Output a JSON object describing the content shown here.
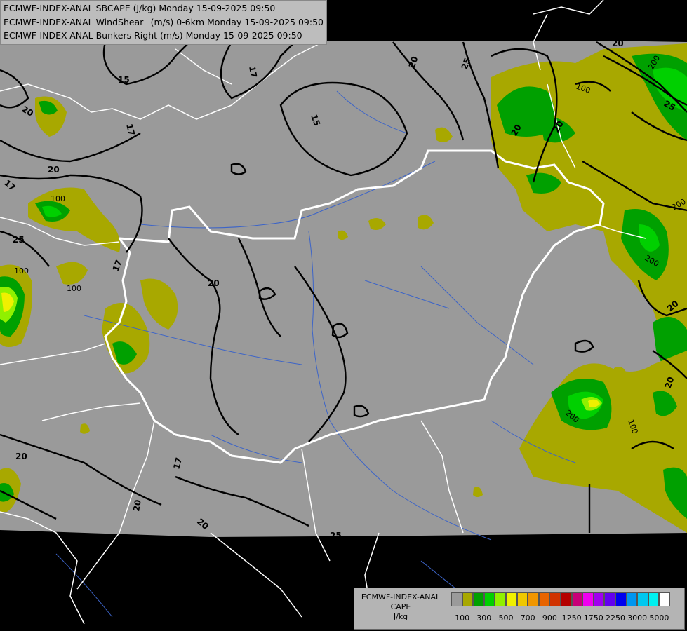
{
  "header": {
    "line1": "ECMWF-INDEX-ANAL SBCAPE (J/kg) Monday 15-09-2025 09:50",
    "line2": "ECMWF-INDEX-ANAL WindShear_ (m/s) 0-6km Monday 15-09-2025 09:50",
    "line3": "ECMWF-INDEX-ANAL Bunkers Right (m/s) Monday 15-09-2025 09:50"
  },
  "legend": {
    "title1": "ECMWF-INDEX-ANAL",
    "title2": "CAPE",
    "title3": "J/kg",
    "colors": [
      "#9a9a9a",
      "#a8a800",
      "#00a000",
      "#00d000",
      "#90f000",
      "#f0f000",
      "#f0c800",
      "#f09600",
      "#e86400",
      "#d03200",
      "#b40000",
      "#c80078",
      "#f000f0",
      "#a000f0",
      "#6400f0",
      "#0000f0",
      "#0096f0",
      "#00c8f0",
      "#00f0f0",
      "#ffffff"
    ],
    "tick_labels": [
      "100",
      "300",
      "500",
      "700",
      "900",
      "1250",
      "1750",
      "2250",
      "3000",
      "5000"
    ]
  },
  "contour_labels": {
    "windshear": [
      "15",
      "15",
      "17",
      "17",
      "17",
      "17",
      "17",
      "20",
      "20",
      "20",
      "20",
      "20",
      "20",
      "20",
      "20",
      "20",
      "20",
      "20",
      "20",
      "25",
      "25",
      "25"
    ],
    "cape": [
      "100",
      "100",
      "100",
      "100",
      "100",
      "200",
      "200",
      "200",
      "200"
    ]
  },
  "colors": {
    "no_data": "#000000",
    "domain": "#9a9a9a",
    "border": "#ffffff",
    "river": "#3c64c8",
    "contour": "#000000"
  }
}
